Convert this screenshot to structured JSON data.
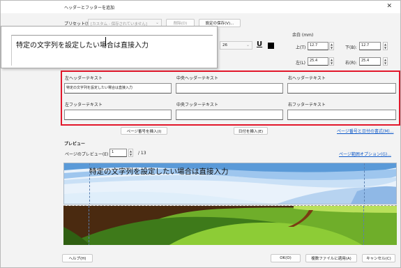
{
  "window": {
    "title": "ヘッダーとフッターを追加",
    "close_glyph": "✕"
  },
  "preset": {
    "label": "プリセット(S):",
    "value": "[カスタム - 保存されていません]",
    "delete_label": "削除(D)",
    "save_label": "設定の保存(V)..."
  },
  "popup": {
    "text": "特定の文字列を設定したい場合は直接入力"
  },
  "font": {
    "size": "26",
    "underline_glyph": "U",
    "color": "#000000"
  },
  "margin": {
    "label": "余白 (mm)",
    "top_label": "上(T)",
    "top_value": "12.7",
    "bottom_label": "下(B):",
    "bottom_value": "12.7",
    "left_label": "左(L)",
    "left_value": "25.4",
    "right_label": "右(R):",
    "right_value": "25.4"
  },
  "fields": {
    "left_header_label": "左ヘッダーテキスト",
    "left_header_value": "特定の文字列を設定したい場合は直接入力",
    "center_header_label": "中央ヘッダーテキスト",
    "center_header_value": "",
    "right_header_label": "右ヘッダーテキスト",
    "right_header_value": "",
    "left_footer_label": "左フッターテキスト",
    "left_footer_value": "",
    "center_footer_label": "中央フッターテキスト",
    "center_footer_value": "",
    "right_footer_label": "右フッターテキスト",
    "right_footer_value": ""
  },
  "insert": {
    "page_number_label": "ページ番号を挿入(I)",
    "date_label": "日付を挿入(E)",
    "format_link": "ページ番号と日付の書式(M)..."
  },
  "preview": {
    "section_label": "プレビュー",
    "page_label": "ページのプレビュー(E)",
    "page_value": "1",
    "page_total": "/ 13",
    "range_link": "ページ範囲オプション(G)...",
    "overlay_text": "特定の文字列を設定したい場合は直接入力"
  },
  "footer_buttons": {
    "help": "ヘルプ(H)",
    "ok": "OK(O)",
    "apply_multiple": "複数ファイルに適用(A)",
    "cancel": "キャンセル(C)"
  },
  "colors": {
    "highlight": "#e2162a",
    "link": "#0b57c8"
  }
}
